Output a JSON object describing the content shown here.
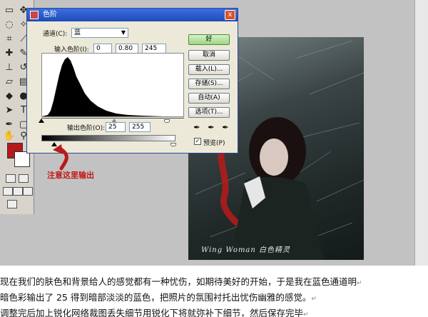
{
  "dialog": {
    "title": "色阶",
    "close_glyph": "x",
    "channel_label": "通道(C):",
    "channel_value": "蓝",
    "input_levels_label": "输入色阶(I):",
    "input_black": "0",
    "input_gamma": "0.80",
    "input_white": "245",
    "output_levels_label": "输出色阶(O):",
    "output_black": "25",
    "output_white": "255",
    "buttons": {
      "ok": "好",
      "cancel": "取消",
      "load": "载入(L)...",
      "save": "存储(S)...",
      "auto": "自动(A)",
      "options": "选项(T)..."
    },
    "preview_label": "预览(P)",
    "preview_checked": true,
    "preview_check_glyph": "✓"
  },
  "annotation": {
    "text": "注意这里输出",
    "color": "#c21818"
  },
  "photo": {
    "caption": "Wing Woman  白色精灵"
  },
  "toolbox": {
    "foreground_color": "#b4191c",
    "background_color": "#ffffff"
  },
  "article": {
    "lines": [
      "现在我们的肤色和背景给人的感觉都有一种忧伤，如期待美好的开始，于是我在蓝色通道明",
      "暗色彩输出了 25 得到暗部淡淡的蓝色，把照片的氛围衬托出忧伤幽雅的感觉。",
      "调整完后加上锐化网络裁图丢失细节用锐化下将就弥补下细节，然后保存完毕"
    ],
    "paragraph_mark": "↵"
  }
}
